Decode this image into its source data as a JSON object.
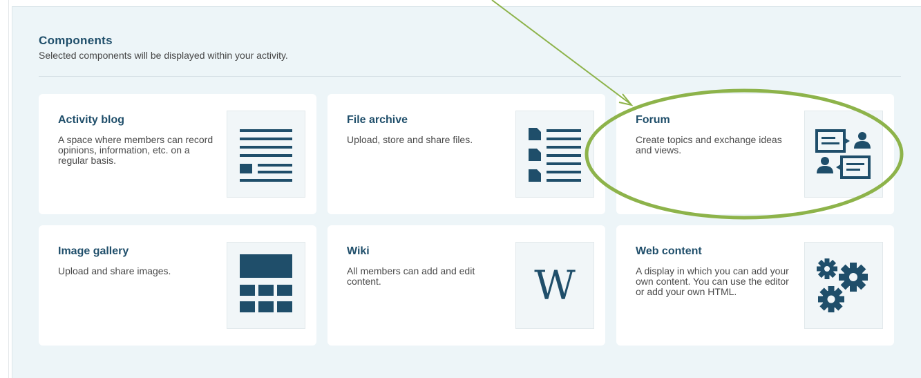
{
  "header": {
    "title": "Components",
    "subtitle": "Selected components will be displayed within your activity."
  },
  "components": [
    {
      "title": "Activity blog",
      "description": "A space where members can record opinions, information, etc. on a regular basis.",
      "icon": "blog-icon"
    },
    {
      "title": "File archive",
      "description": "Upload, store and share files.",
      "icon": "file-archive-icon"
    },
    {
      "title": "Forum",
      "description": "Create topics and exchange ideas and views.",
      "icon": "forum-icon"
    },
    {
      "title": "Image gallery",
      "description": "Upload and share images.",
      "icon": "image-gallery-icon"
    },
    {
      "title": "Wiki",
      "description": "All members can add and edit content.",
      "icon": "wiki-icon",
      "glyph": "W"
    },
    {
      "title": "Web content",
      "description": "A display in which you can add your own content. You can use the editor or add your own HTML.",
      "icon": "gears-icon"
    }
  ],
  "colors": {
    "brand": "#1f4e6a",
    "annotation": "#8db34a",
    "panel": "#edf5f8"
  }
}
